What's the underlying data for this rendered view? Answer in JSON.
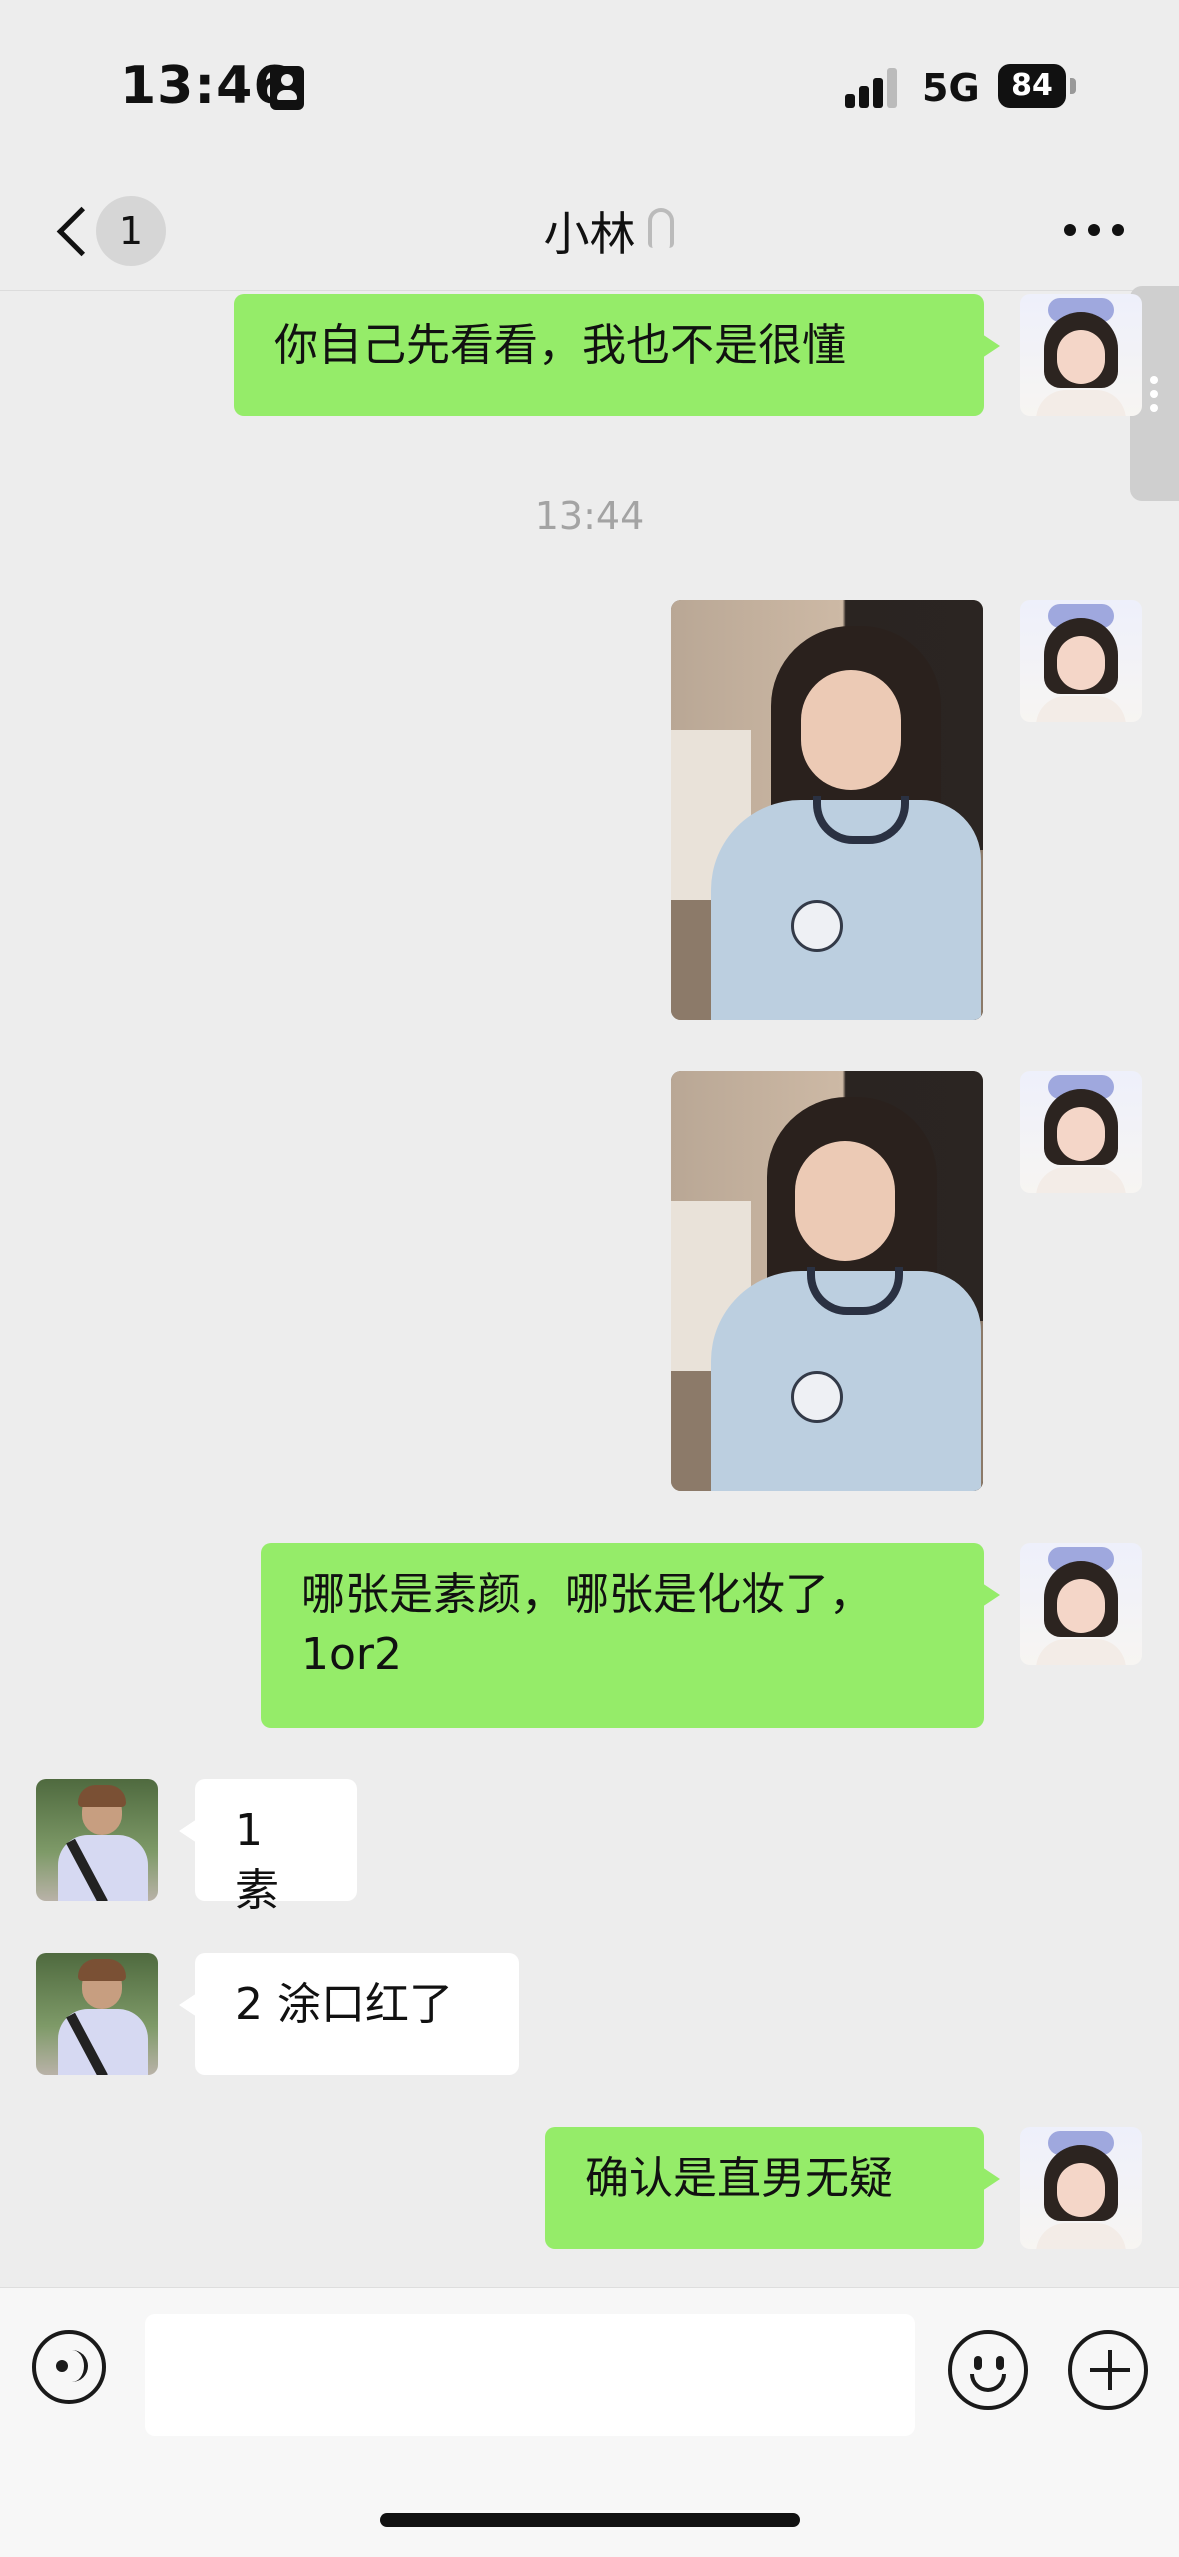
{
  "status_bar": {
    "time": "13:46",
    "network": "5G",
    "battery": "84"
  },
  "nav": {
    "unread_count": "1",
    "title": "小林"
  },
  "chat": {
    "messages": [
      {
        "sender": "me",
        "type": "text",
        "text": "你自己先看看，我也不是很懂"
      },
      {
        "type": "timestamp",
        "text": "13:44"
      },
      {
        "sender": "me",
        "type": "image"
      },
      {
        "sender": "me",
        "type": "image"
      },
      {
        "sender": "me",
        "type": "text",
        "lines": [
          "哪张是素颜，哪张是化妆了，",
          "1or2"
        ]
      },
      {
        "sender": "other",
        "type": "text",
        "text": "1 素"
      },
      {
        "sender": "other",
        "type": "text",
        "text": "2 涂口红了"
      },
      {
        "sender": "me",
        "type": "text",
        "text": "确认是直男无疑"
      }
    ]
  },
  "input_bar": {
    "placeholder": "",
    "icons": [
      "voice-icon",
      "emoji-icon",
      "plus-icon"
    ]
  },
  "colors": {
    "background": "#ededed",
    "my_bubble": "#95ec69",
    "their_bubble": "#ffffff",
    "timestamp": "#a3a3a3"
  }
}
